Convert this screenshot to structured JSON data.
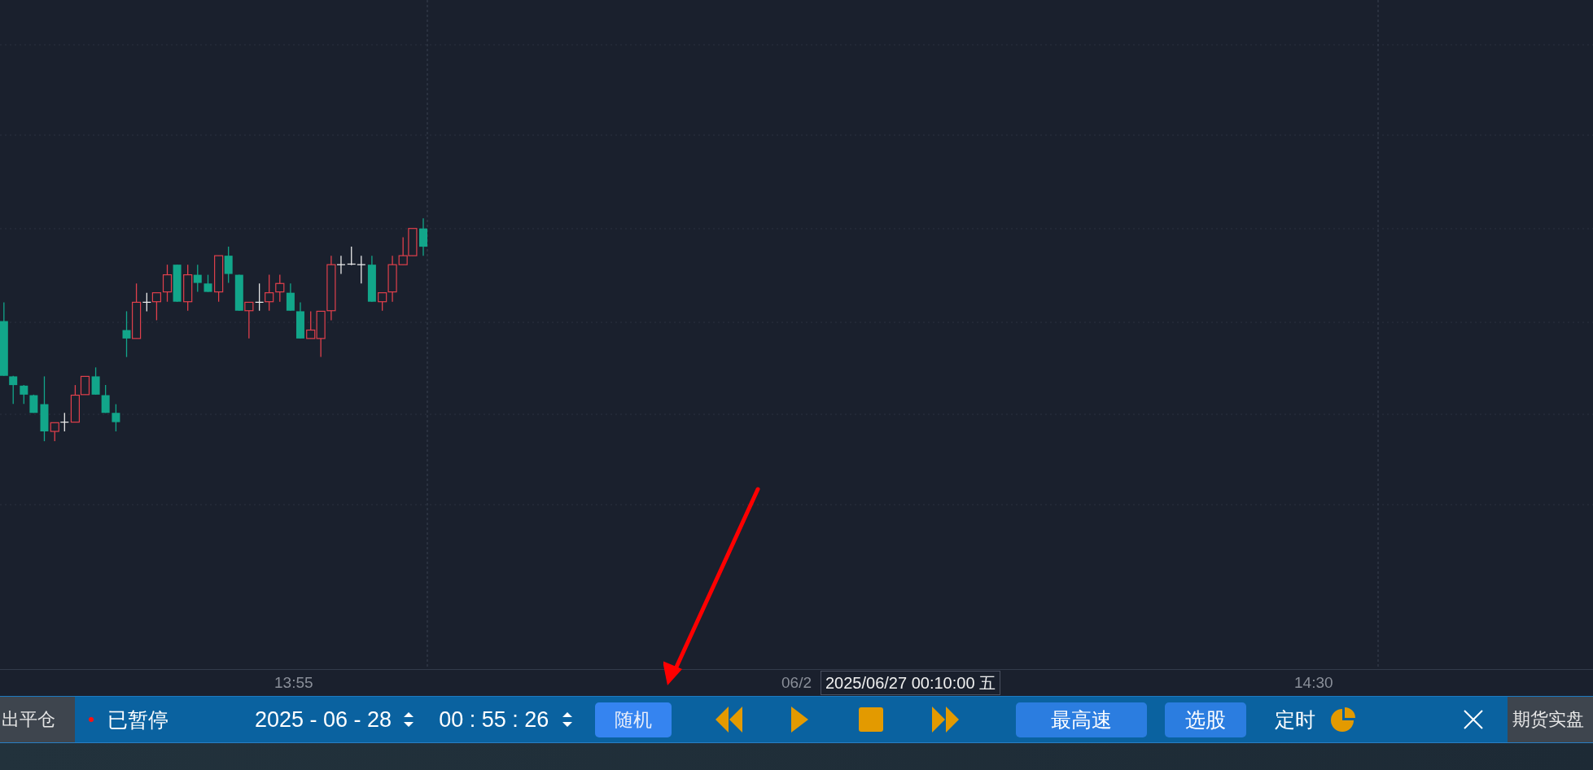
{
  "chart": {
    "time_axis": [
      {
        "label": "13:55"
      },
      {
        "label": "06/2"
      },
      {
        "label": "14:30"
      }
    ],
    "crosshair_label": "2025/06/27 00:10:00 五"
  },
  "toolbar": {
    "left_tab": "出平仓",
    "status": {
      "text": "已暂停",
      "paused": true
    },
    "date": "2025 - 06 - 28",
    "time": "00 : 55 : 26",
    "random_button": "随机",
    "speed_button": "最高速",
    "pick_button": "选股",
    "timer_label": "定时",
    "right_tab": "期货实盘"
  }
}
